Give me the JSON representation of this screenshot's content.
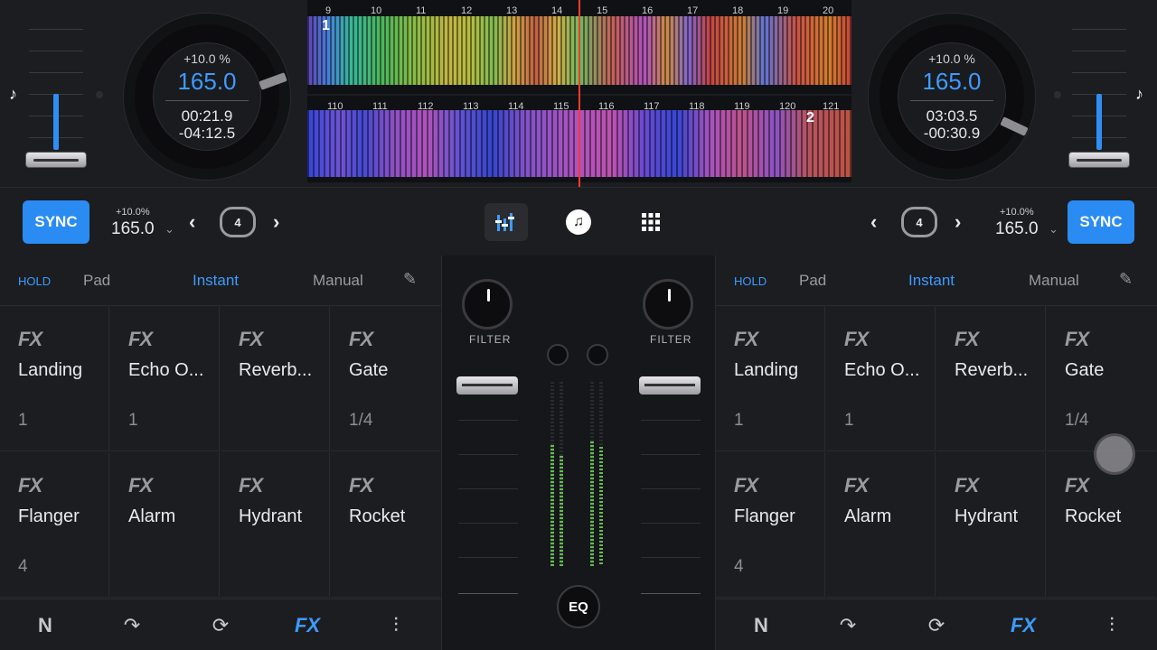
{
  "deck_left": {
    "jog_pct": "+10.0 %",
    "jog_bpm": "165.0",
    "elapsed": "00:21.9",
    "remaining": "-04:12.5",
    "ctrl_pct": "+10.0%",
    "ctrl_bpm": "165.0",
    "loop": "4",
    "sync": "SYNC",
    "note_icon": "♪"
  },
  "deck_right": {
    "jog_pct": "+10.0 %",
    "jog_bpm": "165.0",
    "elapsed": "03:03.5",
    "remaining": "-00:30.9",
    "ctrl_pct": "+10.0%",
    "ctrl_bpm": "165.0",
    "loop": "4",
    "sync": "SYNC",
    "note_icon": "♪"
  },
  "waveform_top": {
    "bars": [
      "9",
      "10",
      "11",
      "12",
      "13",
      "14",
      "15",
      "16",
      "17",
      "18",
      "19",
      "20"
    ],
    "deck": "1"
  },
  "waveform_bottom": {
    "bars": [
      "110",
      "111",
      "112",
      "113",
      "114",
      "115",
      "116",
      "117",
      "118",
      "119",
      "120",
      "121"
    ],
    "deck": "2"
  },
  "fx_tabs": {
    "hold": "HOLD",
    "pad": "Pad",
    "instant": "Instant",
    "manual": "Manual"
  },
  "fx_left": [
    {
      "fx": "FX",
      "name": "Landing",
      "value": "1"
    },
    {
      "fx": "FX",
      "name": "Echo O...",
      "value": "1"
    },
    {
      "fx": "FX",
      "name": "Reverb...",
      "value": ""
    },
    {
      "fx": "FX",
      "name": "Gate",
      "value": "1/4"
    },
    {
      "fx": "FX",
      "name": "Flanger",
      "value": "4"
    },
    {
      "fx": "FX",
      "name": "Alarm",
      "value": ""
    },
    {
      "fx": "FX",
      "name": "Hydrant",
      "value": ""
    },
    {
      "fx": "FX",
      "name": "Rocket",
      "value": ""
    }
  ],
  "fx_right": [
    {
      "fx": "FX",
      "name": "Landing",
      "value": "1"
    },
    {
      "fx": "FX",
      "name": "Echo O...",
      "value": "1"
    },
    {
      "fx": "FX",
      "name": "Reverb...",
      "value": ""
    },
    {
      "fx": "FX",
      "name": "Gate",
      "value": "1/4"
    },
    {
      "fx": "FX",
      "name": "Flanger",
      "value": "4"
    },
    {
      "fx": "FX",
      "name": "Alarm",
      "value": ""
    },
    {
      "fx": "FX",
      "name": "Hydrant",
      "value": ""
    },
    {
      "fx": "FX",
      "name": "Rocket",
      "value": ""
    }
  ],
  "mixer": {
    "filter_label": "FILTER",
    "eq_label": "EQ"
  },
  "nav": {
    "fx": "FX"
  },
  "colors": {
    "accent": "#2a8cf3",
    "bpm": "#3d9bff",
    "bg": "#1c1d20"
  }
}
